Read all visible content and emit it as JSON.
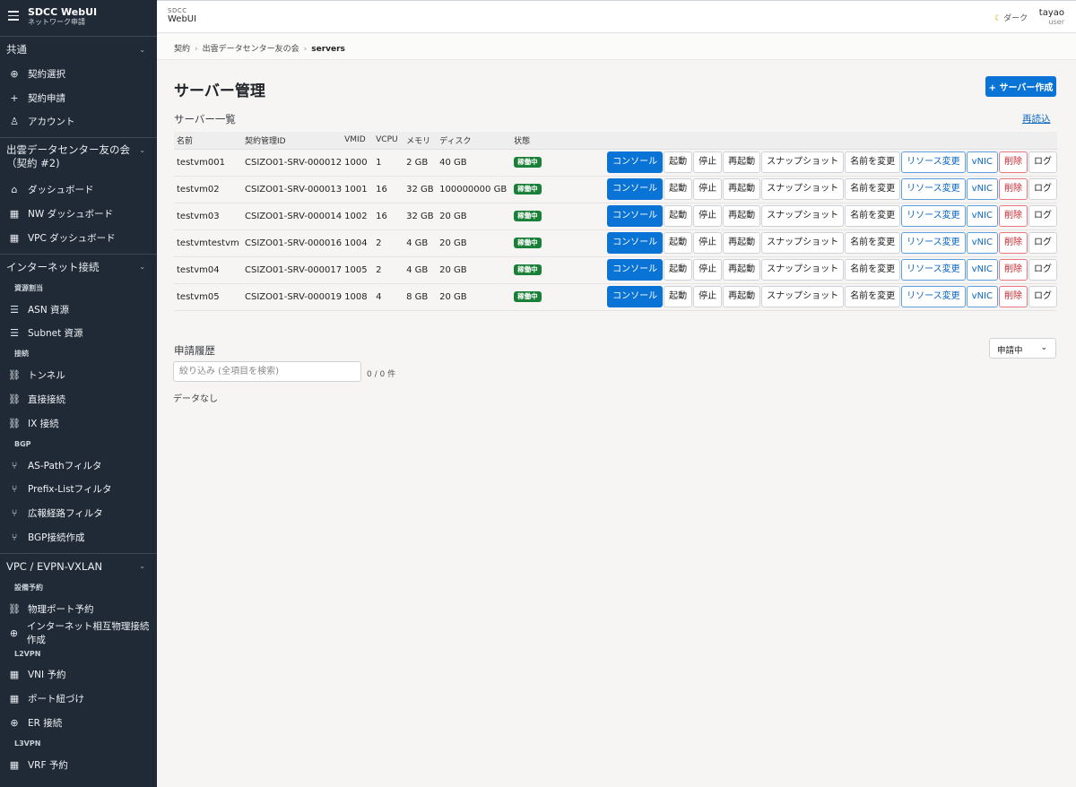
{
  "sidebar": {
    "brand_title": "SDCC WebUI",
    "brand_subtitle": "ネットワーク申請",
    "sections": {
      "common": "共通",
      "contract": "出雲データセンター友の会（契約 #2)",
      "internet": "インターネット接続",
      "vpc": "VPC / EVPN-VXLAN"
    },
    "items": {
      "contract_select": "契約選択",
      "contract_apply": "契約申請",
      "account": "アカウント",
      "dashboard": "ダッシュボード",
      "nw_dashboard": "NW ダッシュボード",
      "vpc_dashboard": "VPC ダッシュボード",
      "asn": "ASN 資源",
      "subnet": "Subnet 資源",
      "tunnel": "トンネル",
      "direct": "直接接続",
      "ix": "IX 接続",
      "aspath": "AS-Pathフィルタ",
      "prefix": "Prefix-Listフィルタ",
      "route_filter": "広報経路フィルタ",
      "bgp_create": "BGP接続作成",
      "phys_port": "物理ポート予約",
      "inet_phys": "インターネット相互物理接続作成",
      "vni": "VNI 予約",
      "port_bind": "ポート紐づけ",
      "er": "ER 接続",
      "vrf": "VRF 予約"
    },
    "groups": {
      "resource": "資源割当",
      "connection": "接続",
      "bgp": "BGP",
      "facility": "設備予約",
      "l2vpn": "L2VPN",
      "l3vpn": "L3VPN"
    }
  },
  "header": {
    "brand_small": "SDCC",
    "brand_big": "WebUI",
    "theme_label": "ダーク",
    "user_name": "tayao",
    "user_role": "user"
  },
  "breadcrumb": {
    "item1": "契約",
    "item2": "出雲データセンター友の会",
    "current": "servers"
  },
  "page": {
    "title": "サーバー管理",
    "create_button": "+ サーバー作成",
    "list_title": "サーバー一覧",
    "reload": "再読込"
  },
  "table": {
    "headers": [
      "名前",
      "契約管理ID",
      "VMID",
      "VCPU",
      "メモリ",
      "ディスク",
      "状態"
    ],
    "actions": [
      "コンソール",
      "起動",
      "停止",
      "再起動",
      "スナップショット",
      "名前を変更",
      "リソース変更",
      "vNIC",
      "削除",
      "ログ"
    ],
    "rows": [
      {
        "name": "testvm001",
        "id": "CSIZO01-SRV-000012",
        "vmid": "1000",
        "vcpu": "1",
        "mem": "2 GB",
        "disk": "40 GB",
        "status": "稼働中"
      },
      {
        "name": "testvm02",
        "id": "CSIZO01-SRV-000013",
        "vmid": "1001",
        "vcpu": "16",
        "mem": "32 GB",
        "disk": "100000000 GB",
        "status": "稼働中"
      },
      {
        "name": "testvm03",
        "id": "CSIZO01-SRV-000014",
        "vmid": "1002",
        "vcpu": "16",
        "mem": "32 GB",
        "disk": "20 GB",
        "status": "稼働中"
      },
      {
        "name": "testvmtestvm",
        "id": "CSIZO01-SRV-000016",
        "vmid": "1004",
        "vcpu": "2",
        "mem": "4 GB",
        "disk": "20 GB",
        "status": "稼働中"
      },
      {
        "name": "testvm04",
        "id": "CSIZO01-SRV-000017",
        "vmid": "1005",
        "vcpu": "2",
        "mem": "4 GB",
        "disk": "20 GB",
        "status": "稼働中"
      },
      {
        "name": "testvm05",
        "id": "CSIZO01-SRV-000019",
        "vmid": "1008",
        "vcpu": "4",
        "mem": "8 GB",
        "disk": "20 GB",
        "status": "稼働中"
      }
    ]
  },
  "history": {
    "title": "申請履歴",
    "filter_value": "申請中",
    "search_placeholder": "絞り込み (全項目を検索)",
    "count": "0 / 0 件",
    "empty": "データなし"
  },
  "colors": {
    "sidebar_bg": "#1f2a36",
    "primary": "#0a73d6",
    "status_running": "#1a7f37",
    "danger": "#d1242f"
  },
  "icons": {
    "menu": "menu-icon",
    "globe": "globe-icon",
    "plus": "plus-icon",
    "user": "user-icon",
    "home": "home-icon",
    "grid": "grid-icon",
    "list": "list-icon",
    "link": "link-icon",
    "branch": "branch-icon",
    "moon": "moon-icon",
    "chevron": "chevron-down-icon"
  }
}
